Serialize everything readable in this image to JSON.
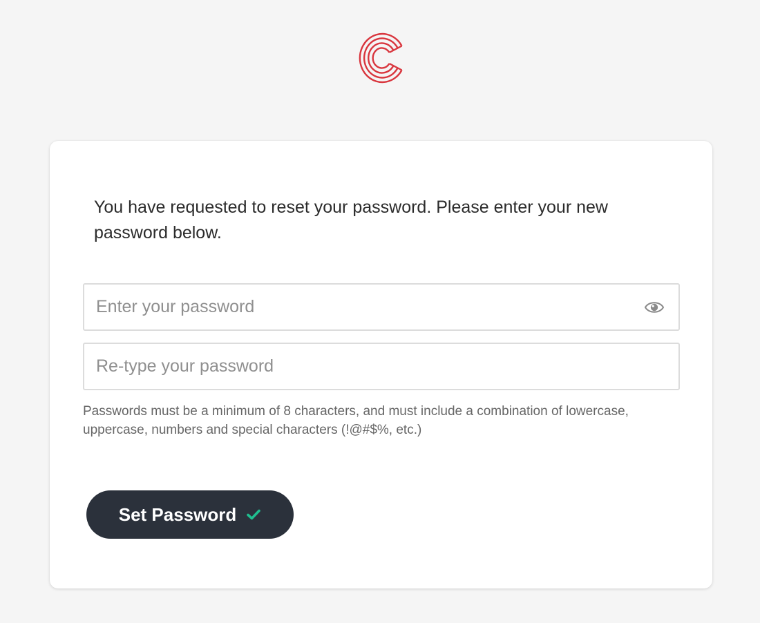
{
  "brand": {
    "logo_icon": "c-logo-icon",
    "logo_color": "#d9363e"
  },
  "card": {
    "intro_text": "You have requested to reset your password. Please enter your new password below.",
    "password_field": {
      "placeholder": "Enter your password",
      "value": "",
      "toggle_icon": "eye-icon"
    },
    "confirm_field": {
      "placeholder": "Re-type your password",
      "value": ""
    },
    "hint_text": "Passwords must be a minimum of 8 characters, and must include a combination of lowercase, uppercase, numbers and special characters (!@#$%, etc.)",
    "submit": {
      "label": "Set Password",
      "icon": "check-icon",
      "icon_color": "#1fbf8f",
      "background": "#2b313b"
    }
  }
}
